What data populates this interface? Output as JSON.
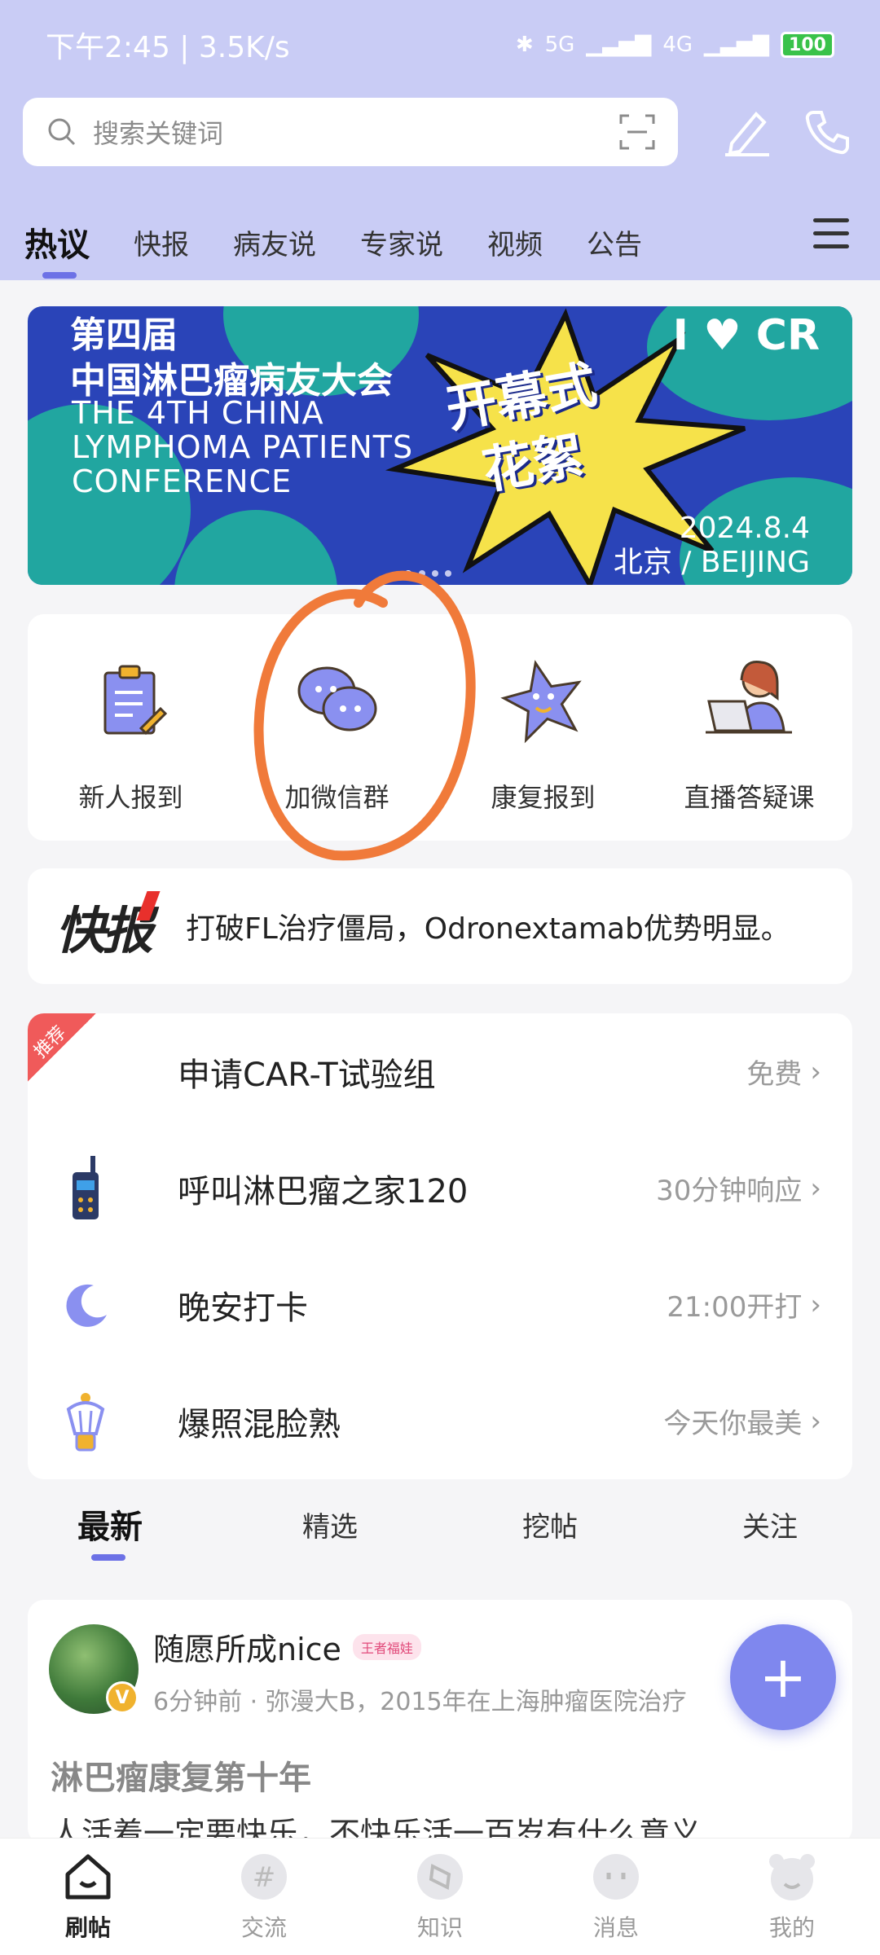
{
  "status_bar": {
    "time_speed": "下午2:45 | 3.5K/s",
    "signal1": "5G",
    "signal2": "4G",
    "battery": "100"
  },
  "search": {
    "placeholder": "搜索关键词"
  },
  "top_tabs": [
    "热议",
    "快报",
    "病友说",
    "专家说",
    "视频",
    "公告"
  ],
  "banner": {
    "title_line1": "第四届",
    "title_line2": "中国淋巴瘤病友大会",
    "en_line1": "THE 4TH CHINA",
    "en_line2": "LYMPHOMA PATIENTS",
    "en_line3": "CONFERENCE",
    "slogan_line1": "开幕式",
    "slogan_line2": "花絮",
    "brand": "I ♥ CR",
    "date": "2024.8.4",
    "place": "北京 / BEIJING"
  },
  "quick_actions": [
    {
      "label": "新人报到",
      "icon": "clipboard-icon"
    },
    {
      "label": "加微信群",
      "icon": "chat-bubbles-icon"
    },
    {
      "label": "康复报到",
      "icon": "star-icon"
    },
    {
      "label": "直播答疑课",
      "icon": "laptop-person-icon"
    }
  ],
  "news": {
    "label": "快报",
    "text": "打破FL治疗僵局，Odronextamab优势明显。"
  },
  "menu_rows": [
    {
      "title": "申请CAR-T试验组",
      "right": "免费",
      "icon": "recommend-tag-icon",
      "tag": "推荐"
    },
    {
      "title": "呼叫淋巴瘤之家120",
      "right": "30分钟响应",
      "icon": "walkie-talkie-icon"
    },
    {
      "title": "晚安打卡",
      "right": "21:00开打",
      "icon": "moon-icon"
    },
    {
      "title": "爆照混脸熟",
      "right": "今天你最美",
      "icon": "ice-cream-icon"
    }
  ],
  "sub_tabs": [
    "最新",
    "精选",
    "挖帖",
    "关注"
  ],
  "post": {
    "user": "随愿所成nice",
    "badge": "王者福娃",
    "meta": "6分钟前 · 弥漫大B，2015年在上海肿瘤医院治疗",
    "title": "淋巴瘤康复第十年",
    "body": "人活着一定要快乐，不快乐活一百岁有什么意义"
  },
  "bottom_nav": [
    "刷帖",
    "交流",
    "知识",
    "消息",
    "我的"
  ],
  "colors": {
    "header": "#c9ccf5",
    "accent": "#6c71e6",
    "fab": "#7f87ee",
    "annotation": "#f07a3a"
  }
}
